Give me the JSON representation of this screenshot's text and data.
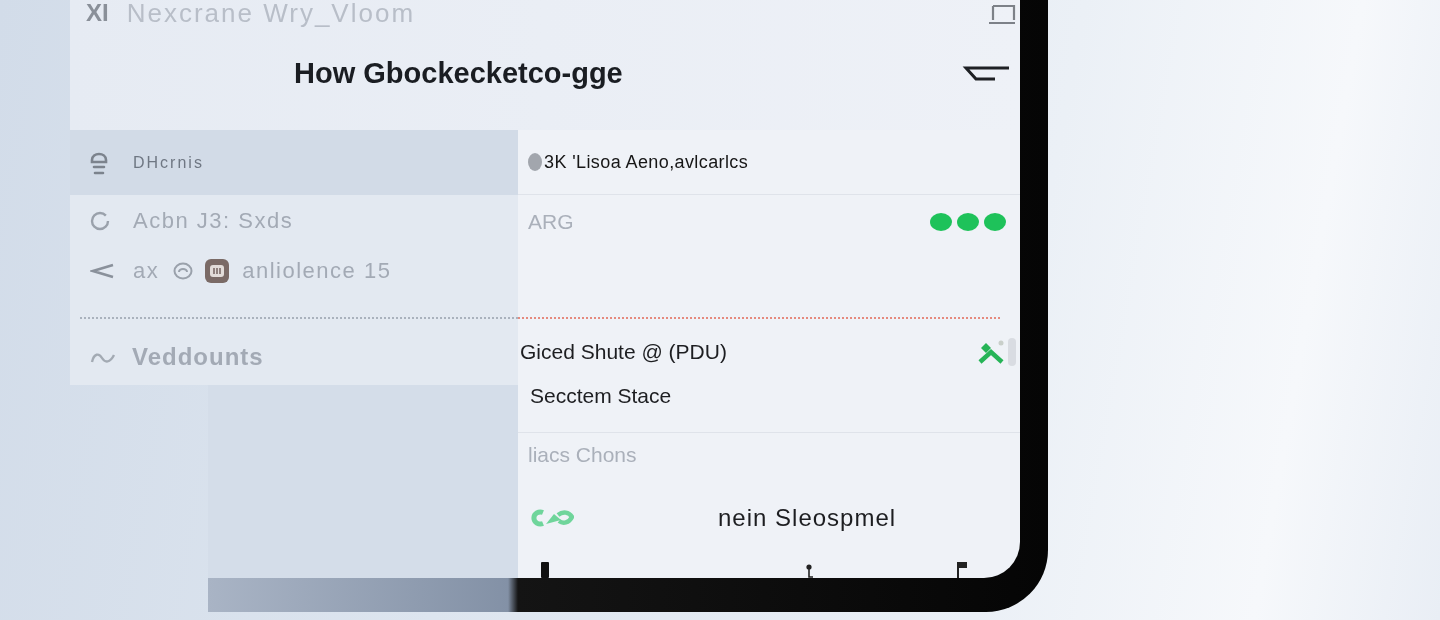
{
  "header": {
    "app_mark": "XI",
    "app_name": "Nexcrane Wry_Vloom",
    "title": "How Gbockecketco-gge"
  },
  "side_panel": {
    "items": [
      {
        "kind": "caption",
        "label": "DHcrnis",
        "selected": true
      },
      {
        "kind": "entry",
        "label": "Acbn J3: Sxds",
        "selected": false
      },
      {
        "kind": "entry-icons",
        "lead": "ax",
        "label": "anliolence 15",
        "selected": false
      },
      {
        "kind": "heading",
        "label": "Veddounts",
        "selected": false
      }
    ]
  },
  "screen": {
    "rows": [
      {
        "kind": "title",
        "label": "3K 'Lisoa Aeno,avlcarlcs"
      },
      {
        "kind": "dots",
        "label": "ARG"
      },
      {
        "kind": "action",
        "label": "Giced Shute @ (PDU)"
      },
      {
        "kind": "plain",
        "label": "Secctem Stace"
      },
      {
        "kind": "muted",
        "label": "liacs Chons"
      },
      {
        "kind": "footer",
        "label": "nein Sleospmel"
      }
    ]
  }
}
